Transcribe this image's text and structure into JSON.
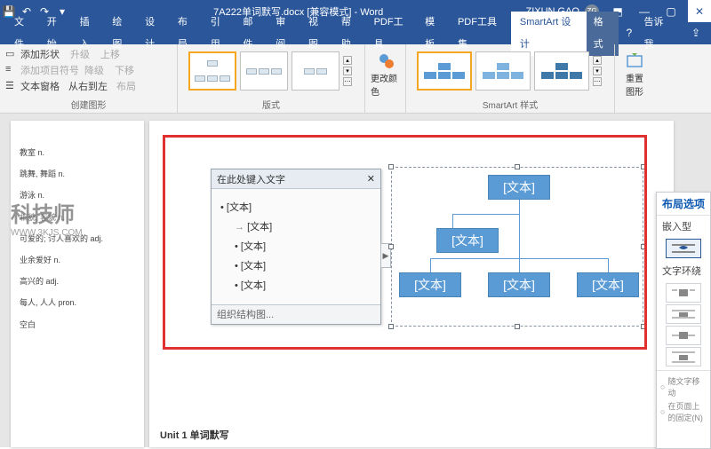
{
  "titlebar": {
    "filename": "7A222单词默写.docx [兼容模式] - Word",
    "user_name": "ZIXUN GAO",
    "user_initials": "ZG"
  },
  "menubar": {
    "items": [
      "文件",
      "开始",
      "插入",
      "绘图",
      "设计",
      "布局",
      "引用",
      "邮件",
      "审阅",
      "视图",
      "帮助",
      "PDF工具",
      "模板",
      "PDF工具集"
    ],
    "smartart_design": "SmartArt 设计",
    "format": "格式",
    "tell_me": "告诉我"
  },
  "ribbon": {
    "group_create": {
      "add_shape": "添加形状",
      "add_bullet": "添加项目符号",
      "text_pane": "文本窗格",
      "promote": "升级",
      "demote": "降级",
      "rtl": "从右到左",
      "move_up": "上移",
      "move_down": "下移",
      "layout": "布局",
      "label": "创建图形"
    },
    "group_layouts": {
      "label": "版式"
    },
    "group_colors": {
      "change_colors": "更改颜色"
    },
    "group_styles": {
      "label": "SmartArt 样式"
    },
    "group_reset": {
      "reset": "重置",
      "reset_graphic": "图形"
    }
  },
  "text_pane": {
    "title": "在此处键入文字",
    "items": [
      "[文本]",
      "[文本]",
      "[文本]",
      "[文本]",
      "[文本]"
    ],
    "footer": "组织结构图..."
  },
  "smartart": {
    "node1": "[文本]",
    "node2": "[文本]",
    "node3": "[文本]",
    "node4": "[文本]",
    "node5": "[文本]"
  },
  "layout_panel": {
    "title": "布局选项",
    "inline": "嵌入型",
    "wrap": "文字环绕",
    "move_with_text": "随文字移动",
    "fix_on_page": "在页面上的固定(N)"
  },
  "page_left": {
    "lines": [
      "教室 n.",
      "跳舞, 舞蹈 n.",
      "游泳 n.",
      "相貌, 容貌 n.",
      "可爱的; 讨人喜欢的 adj.",
      "业余爱好 n.",
      "高兴的 adj.",
      "每人, 人人 pron.",
      "空白"
    ]
  },
  "page_right_footer": "Unit 1 单词默写",
  "watermark": {
    "text": "科技师",
    "url": "WWW.3KJS.COM"
  },
  "colors": {
    "primary": "#2b579a",
    "accent_blue": "#5b9bd5",
    "red_box": "#e03030",
    "gallery_sel": "#f5a623"
  }
}
